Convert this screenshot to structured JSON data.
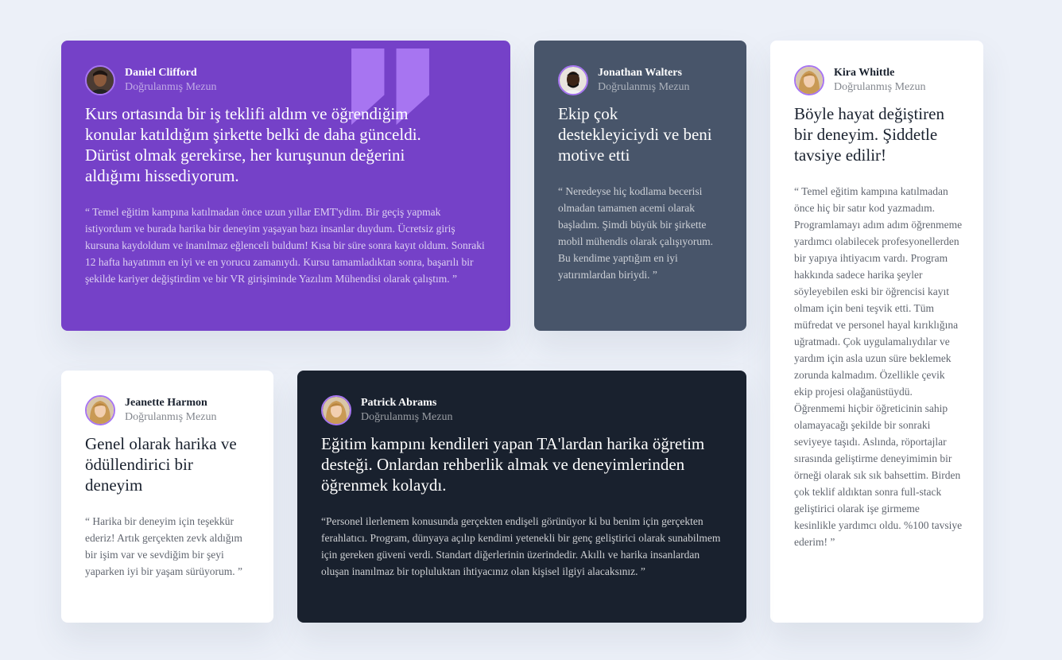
{
  "testimonials": [
    {
      "name": "Daniel Clifford",
      "role": "Doğrulanmış Mezun",
      "headline": "Kurs ortasında bir iş teklifi aldım ve öğrendiğim konular katıldığım şirkette belki de daha günceldi. Dürüst olmak gerekirse, her kuruşunun değerini aldığımı hissediyorum.",
      "body": "“ Temel eğitim kampına katılmadan önce uzun yıllar EMT'ydim. Bir geçiş yapmak istiyordum ve burada harika bir deneyim yaşayan bazı insanlar duydum. Ücretsiz giriş kursuna kaydoldum ve inanılmaz eğlenceli buldum! Kısa bir süre sonra kayıt oldum. Sonraki 12 hafta hayatımın en iyi ve en yorucu zamanıydı. Kursu tamamladıktan sonra, başarılı bir şekilde kariyer değiştirdim ve bir VR girişiminde Yazılım Mühendisi olarak çalıştım. ”",
      "bg": "#7541c8"
    },
    {
      "name": "Jonathan Walters",
      "role": "Doğrulanmış Mezun",
      "headline": "Ekip çok destekleyiciydi ve beni motive etti",
      "body": "“ Neredeyse hiç kodlama becerisi olmadan tamamen acemi olarak başladım. Şimdi büyük bir şirkette mobil mühendis olarak çalışıyorum. Bu kendime yaptığım en iyi yatırımlardan biriydi. ”",
      "bg": "#48556a"
    },
    {
      "name": "Kira Whittle",
      "role": "Doğrulanmış Mezun",
      "headline": "Böyle hayat değiştiren bir deneyim. Şiddetle tavsiye edilir!",
      "body": "“ Temel eğitim kampına katılmadan önce hiç bir satır kod yazmadım. Programlamayı adım adım öğrenmeme yardımcı olabilecek profesyonellerden bir yapıya ihtiyacım vardı. Program hakkında sadece harika şeyler söyleyebilen eski bir öğrencisi kayıt olmam için beni teşvik etti. Tüm müfredat ve personel hayal kırıklığına uğratmadı. Çok uygulamalıydılar ve yardım için asla uzun süre beklemek zorunda kalmadım. Özellikle çevik ekip projesi olağanüstüydü. Öğrenmemi hiçbir öğreticinin sahip olamayacağı şekilde bir sonraki seviyeye taşıdı. Aslında, röportajlar sırasında geliştirme deneyimimin bir örneği olarak sık sık bahsettim. Birden çok teklif aldıktan sonra full-stack geliştirici olarak işe girmeme kesinlikle yardımcı oldu. %100 tavsiye ederim! ”",
      "bg": "#ffffff"
    },
    {
      "name": "Jeanette Harmon",
      "role": "Doğrulanmış Mezun",
      "headline": "Genel olarak harika ve ödüllendirici bir deneyim",
      "body": "“ Harika bir deneyim için teşekkür ederiz! Artık gerçekten zevk aldığım bir işim var ve sevdiğim bir şeyi yaparken iyi bir yaşam sürüyorum. ”",
      "bg": "#ffffff"
    },
    {
      "name": "Patrick Abrams",
      "role": "Doğrulanmış Mezun",
      "headline": "Eğitim kampını kendileri yapan TA'lardan harika öğretim desteği. Onlardan rehberlik almak ve deneyimlerinden öğrenmek kolaydı.",
      "body": "“Personel ilerlemem konusunda gerçekten endişeli görünüyor ki bu benim için gerçekten ferahlatıcı. Program, dünyaya açılıp kendimi yetenekli bir genç geliştirici olarak sunabilmem için gereken güveni verdi. Standart diğerlerinin üzerindedir. Akıllı ve harika insanlardan oluşan inanılmaz bir topluluktan ihtiyacınız olan kişisel ilgiyi alacaksınız. ”",
      "bg": "#19212e"
    }
  ],
  "icons": {
    "quote": "quote-icon",
    "avatar": "avatar-photo"
  },
  "colors": {
    "page_bg": "#ecf0f8",
    "avatar_ring": "#a775f1",
    "quote_mark": "#a775f1"
  }
}
